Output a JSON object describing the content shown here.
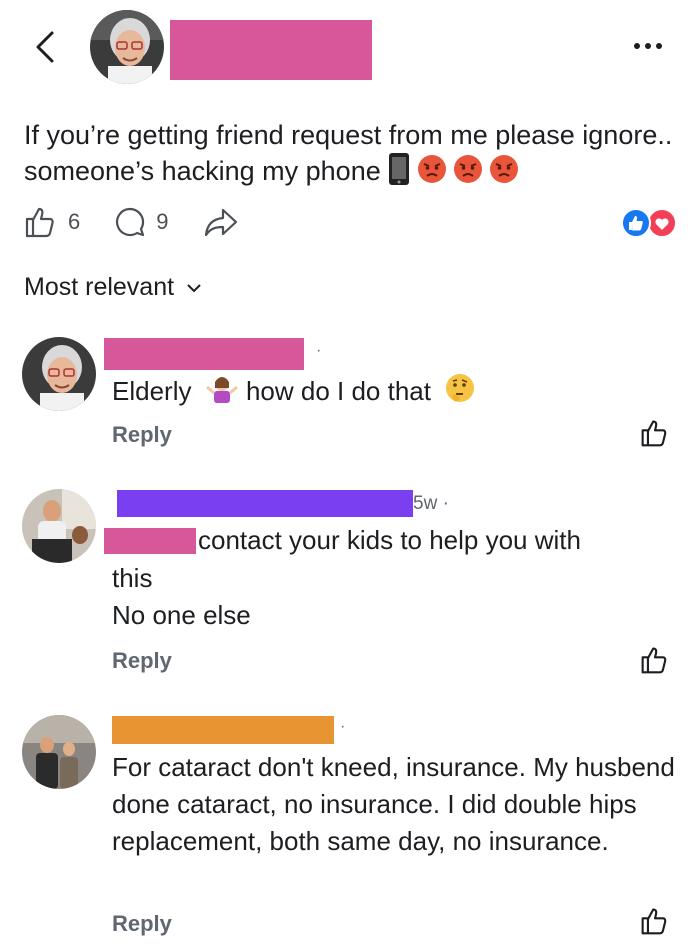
{
  "post": {
    "text": "If you’re getting friend request from me please ignore.. someone’s hacking my phone",
    "likes": "6",
    "comments": "9",
    "emoji_names": [
      "mobile-phone-emoji",
      "angry-face-emoji",
      "angry-face-emoji",
      "angry-face-emoji"
    ]
  },
  "sort": {
    "label": "Most relevant"
  },
  "comments": [
    {
      "text_before": "Elderly",
      "text_after": "how do I do that",
      "reply": "Reply"
    },
    {
      "time": "5w ·",
      "line1": "contact your kids to help you with",
      "line2": "this",
      "line3": "No one else",
      "reply": "Reply"
    },
    {
      "text": "For cataract  don't kneed, insurance. My husbend done cataract,  no insurance.  I did double hips replacement,  both same day, no insurance.",
      "reply": "Reply"
    }
  ],
  "colors": {
    "pink_redaction": "#d6589b",
    "purple_redaction": "#7b3ff2",
    "orange_redaction": "#e69532",
    "like_blue": "#1877f2",
    "love_red": "#f33e58"
  }
}
